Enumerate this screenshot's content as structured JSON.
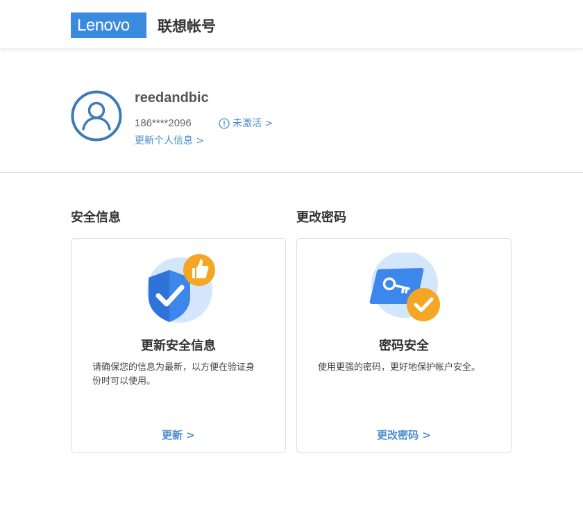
{
  "header": {
    "logo_text": "Lenovo",
    "logo_mark": ".",
    "title": "联想帐号"
  },
  "profile": {
    "username": "reedandbic",
    "phone": "186****2096",
    "status_label": "未激活 >",
    "update_link": "更新个人信息 >"
  },
  "sections": [
    {
      "heading": "安全信息",
      "card_title": "更新安全信息",
      "card_desc": "请确保您的信息为最新，以方便在验证身份时可以使用。",
      "link": "更新 >",
      "icon": "shield-thumbs-up-icon"
    },
    {
      "heading": "更改密码",
      "card_title": "密码安全",
      "card_desc": "使用更强的密码，更好地保护帐户安全。",
      "link": "更改密码 >",
      "icon": "key-card-check-icon"
    }
  ],
  "colors": {
    "brand": "#3a8ae0",
    "link": "#4a8ccf",
    "accent_orange": "#f5a623"
  }
}
